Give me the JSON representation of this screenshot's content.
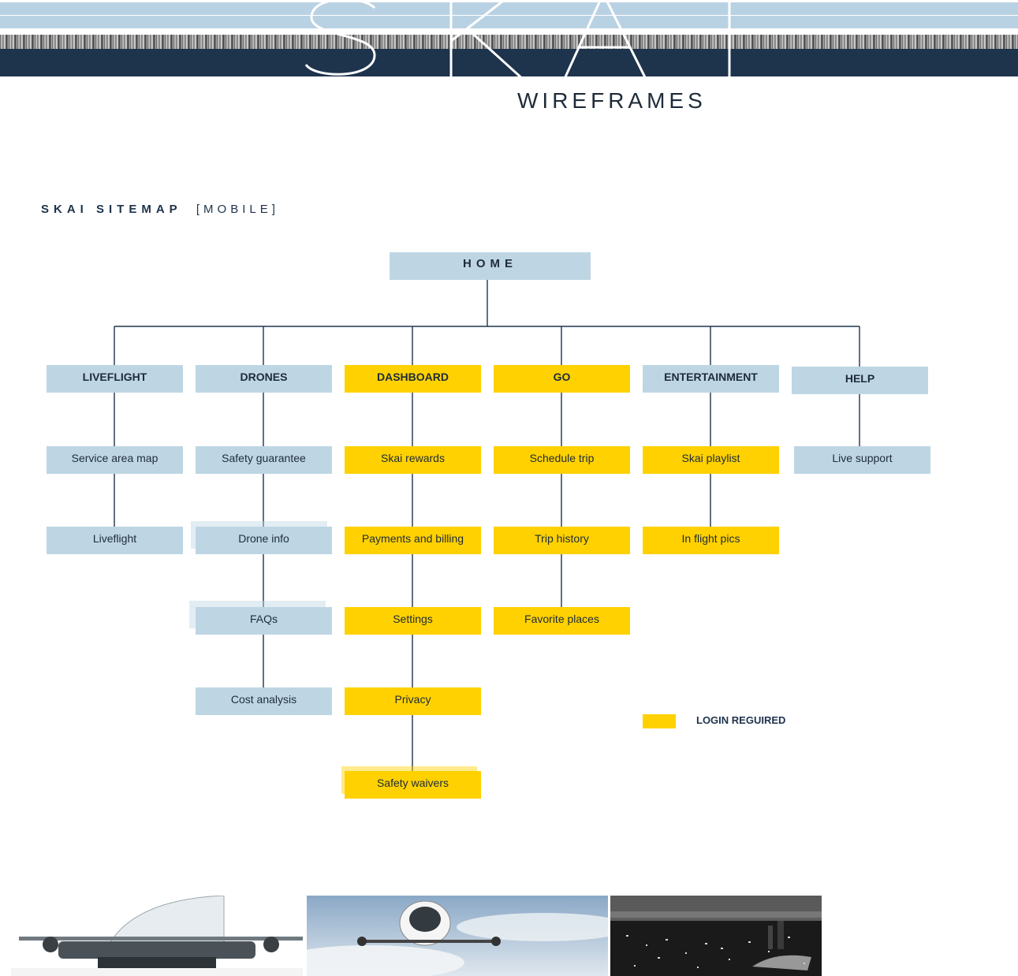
{
  "header": {
    "logo_text": "SKAI",
    "subtitle": "WIREFRAMES"
  },
  "section": {
    "title_bold": "SKAI SITEMAP",
    "title_light": "[MOBILE]"
  },
  "sitemap": {
    "root": "HOME",
    "columns": [
      {
        "label": "LIVEFLIGHT",
        "login_required": false,
        "children": [
          "Service area map",
          "Liveflight"
        ]
      },
      {
        "label": "DRONES",
        "login_required": false,
        "children": [
          "Safety guarantee",
          "Drone info",
          "FAQs",
          "Cost analysis"
        ]
      },
      {
        "label": "DASHBOARD",
        "login_required": true,
        "children": [
          "Skai rewards",
          "Payments and billing",
          "Settings",
          "Privacy",
          "Safety waivers"
        ]
      },
      {
        "label": "GO",
        "login_required": true,
        "children": [
          "Schedule trip",
          "Trip history",
          "Favorite places"
        ]
      },
      {
        "label": "ENTERTAINMENT",
        "login_required": true,
        "children": [
          "Skai playlist",
          "In flight pics"
        ]
      },
      {
        "label": "HELP",
        "login_required": false,
        "children": [
          "Live support"
        ]
      }
    ]
  },
  "legend": {
    "label": "LOGIN REGUIRED",
    "color": "#ffd100"
  },
  "colors": {
    "public": "#bed6e4",
    "login": "#ffd100",
    "navy": "#1e334c"
  },
  "photos": [
    {
      "name": "drone-cockpit-photo"
    },
    {
      "name": "drone-sky-photo"
    },
    {
      "name": "city-night-photo"
    }
  ]
}
